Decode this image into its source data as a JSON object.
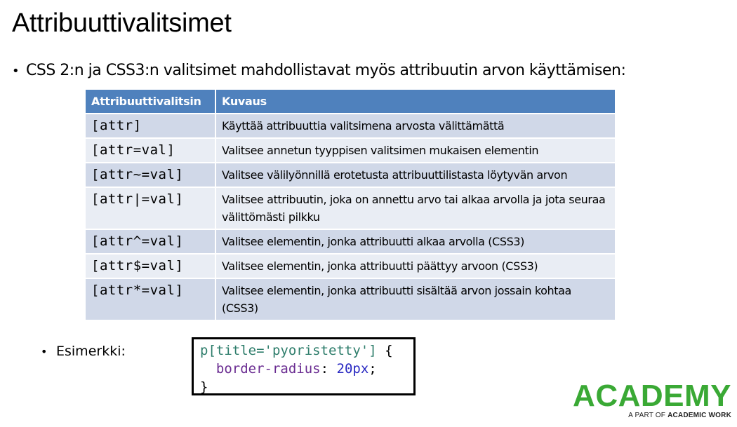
{
  "slide": {
    "title": "Attribuuttivalitsimet",
    "intro": "CSS 2:n ja CSS3:n valitsimet mahdollistavat myös attribuutin arvon käyttämisen:",
    "bullet_symbol": "•"
  },
  "table": {
    "headers": [
      "Attribuuttivalitsin",
      "Kuvaus"
    ],
    "rows": [
      {
        "selector": "[attr]",
        "description": "Käyttää attribuuttia valitsimena arvosta välittämättä"
      },
      {
        "selector": "[attr=val]",
        "description": "Valitsee annetun tyyppisen valitsimen mukaisen elementin"
      },
      {
        "selector": "[attr~=val]",
        "description": "Valitsee välilyönnillä erotetusta attribuuttilistasta löytyvän arvon"
      },
      {
        "selector": "[attr|=val]",
        "description": "Valitsee attribuutin, joka on annettu arvo tai alkaa arvolla ja jota seuraa välittömästi pilkku"
      },
      {
        "selector": "[attr^=val]",
        "description": "Valitsee elementin, jonka attribuutti alkaa arvolla (CSS3)"
      },
      {
        "selector": "[attr$=val]",
        "description": "Valitsee elementin, jonka attribuutti päättyy arvoon (CSS3)"
      },
      {
        "selector": "[attr*=val]",
        "description": "Valitsee elementin, jonka attribuutti sisältää arvon jossain kohtaa (CSS3)"
      }
    ]
  },
  "example": {
    "label": "Esimerkki:",
    "code": {
      "selector_tag": "p",
      "selector_open": "[title=",
      "selector_value": "'pyoristetty'",
      "selector_close": "]",
      "open_brace": " {",
      "property": "border-radius",
      "colon": ":",
      "value": "20px",
      "semicolon": ";",
      "close_brace": "}"
    }
  },
  "logo": {
    "name": "ACADEMY",
    "tagline_prefix": "A PART OF ",
    "tagline_brand": "ACADEMIC WORK",
    "color": "#3aa935"
  },
  "colors": {
    "header_bg": "#4f81bd",
    "row_odd": "#d0d8e8",
    "row_even": "#e9edf4"
  }
}
